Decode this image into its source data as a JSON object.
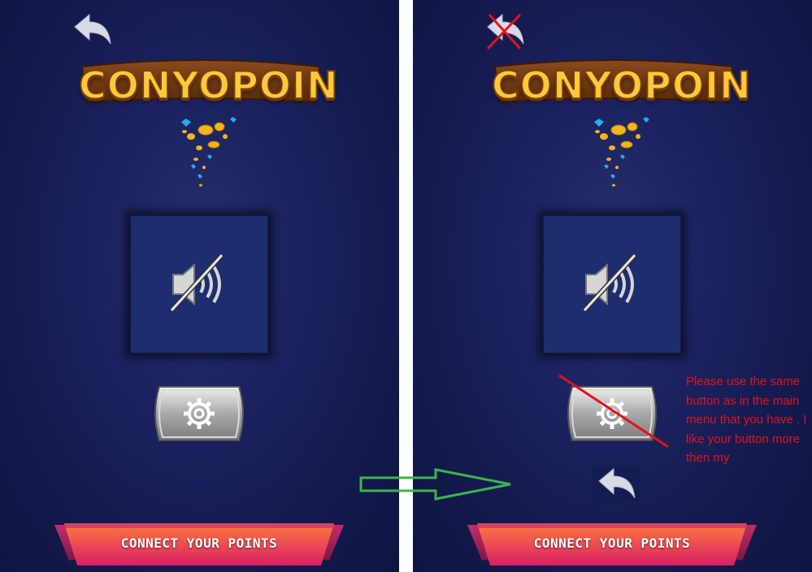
{
  "screens": [
    {
      "title": "CONYOPOIN",
      "connect_label": "CONNECT YOUR POINTS"
    },
    {
      "title": "CONYOPOIN",
      "connect_label": "CONNECT YOUR POINTS",
      "annotation_text": "Please use the same button as in the main menu that you have . I like your button more then my"
    }
  ],
  "icons": {
    "back": "back-arrow-icon",
    "sound": "sound-muted-icon",
    "settings": "gear-icon",
    "strike": "red-cross-mark",
    "arrow": "green-arrow"
  },
  "colors": {
    "background": "#1a2058",
    "annotation": "#e3121b",
    "arrow": "#3bb54a",
    "connect_gradient": [
      "#ff6a3c",
      "#d21f63"
    ],
    "logo_text": "#ffc83a"
  }
}
